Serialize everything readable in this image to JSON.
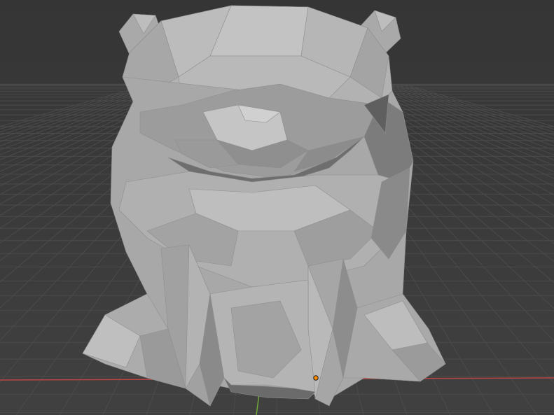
{
  "viewport": {
    "background_color": "#3b3b3b",
    "grid_color": "#4a4a4a",
    "x_axis_color": "#c84a4a",
    "y_axis_color": "#6fa83a",
    "origin_marker_color": "#ff8c00",
    "model_base_color": "#a6a6a6",
    "model_shadow_color": "#6a6a6a",
    "model_highlight_color": "#c4c4c4"
  },
  "scene": {
    "object": "low-poly-bear-model",
    "icons": [
      "origin-point-icon"
    ]
  }
}
